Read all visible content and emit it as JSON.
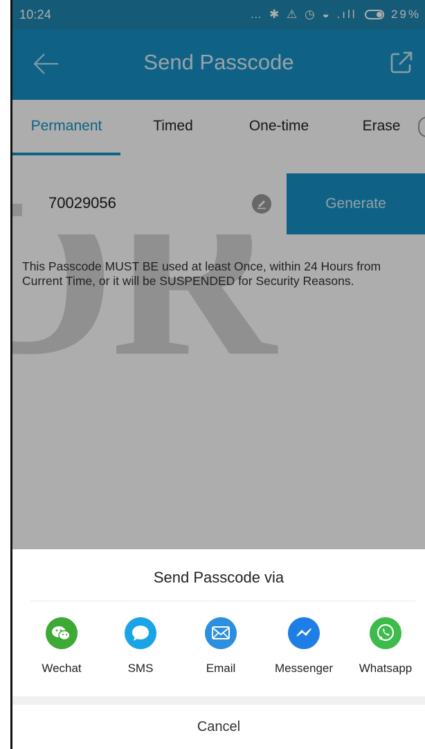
{
  "status_bar": {
    "time": "10:24",
    "icons_text": "… ✱ ⚠ ◷ ◒ .ıll",
    "battery": "29%"
  },
  "app_bar": {
    "title": "Send Passcode"
  },
  "tabs": [
    {
      "label": "Permanent",
      "active": true
    },
    {
      "label": "Timed",
      "active": false
    },
    {
      "label": "One-time",
      "active": false
    },
    {
      "label": "Erase",
      "active": false
    }
  ],
  "passcode": {
    "value": "70029056",
    "generate_label": "Generate"
  },
  "notice": "This Passcode MUST BE used at least Once, within 24 Hours from Current Time, or it will be SUSPENDED for Security Reasons.",
  "watermark": "DR",
  "sheet": {
    "title": "Send Passcode via",
    "options": [
      {
        "label": "Wechat",
        "icon": "wechat-icon",
        "color": "#3daa35"
      },
      {
        "label": "SMS",
        "icon": "sms-icon",
        "color": "#18a4e7"
      },
      {
        "label": "Email",
        "icon": "email-icon",
        "color": "#2c8fe0"
      },
      {
        "label": "Messenger",
        "icon": "messenger-icon",
        "color": "#1f7ee6"
      },
      {
        "label": "Whatsapp",
        "icon": "whatsapp-icon",
        "color": "#3dbb4b"
      }
    ],
    "cancel_label": "Cancel"
  },
  "colors": {
    "primary": "#1791c4",
    "status_bar": "#1f87b0"
  }
}
